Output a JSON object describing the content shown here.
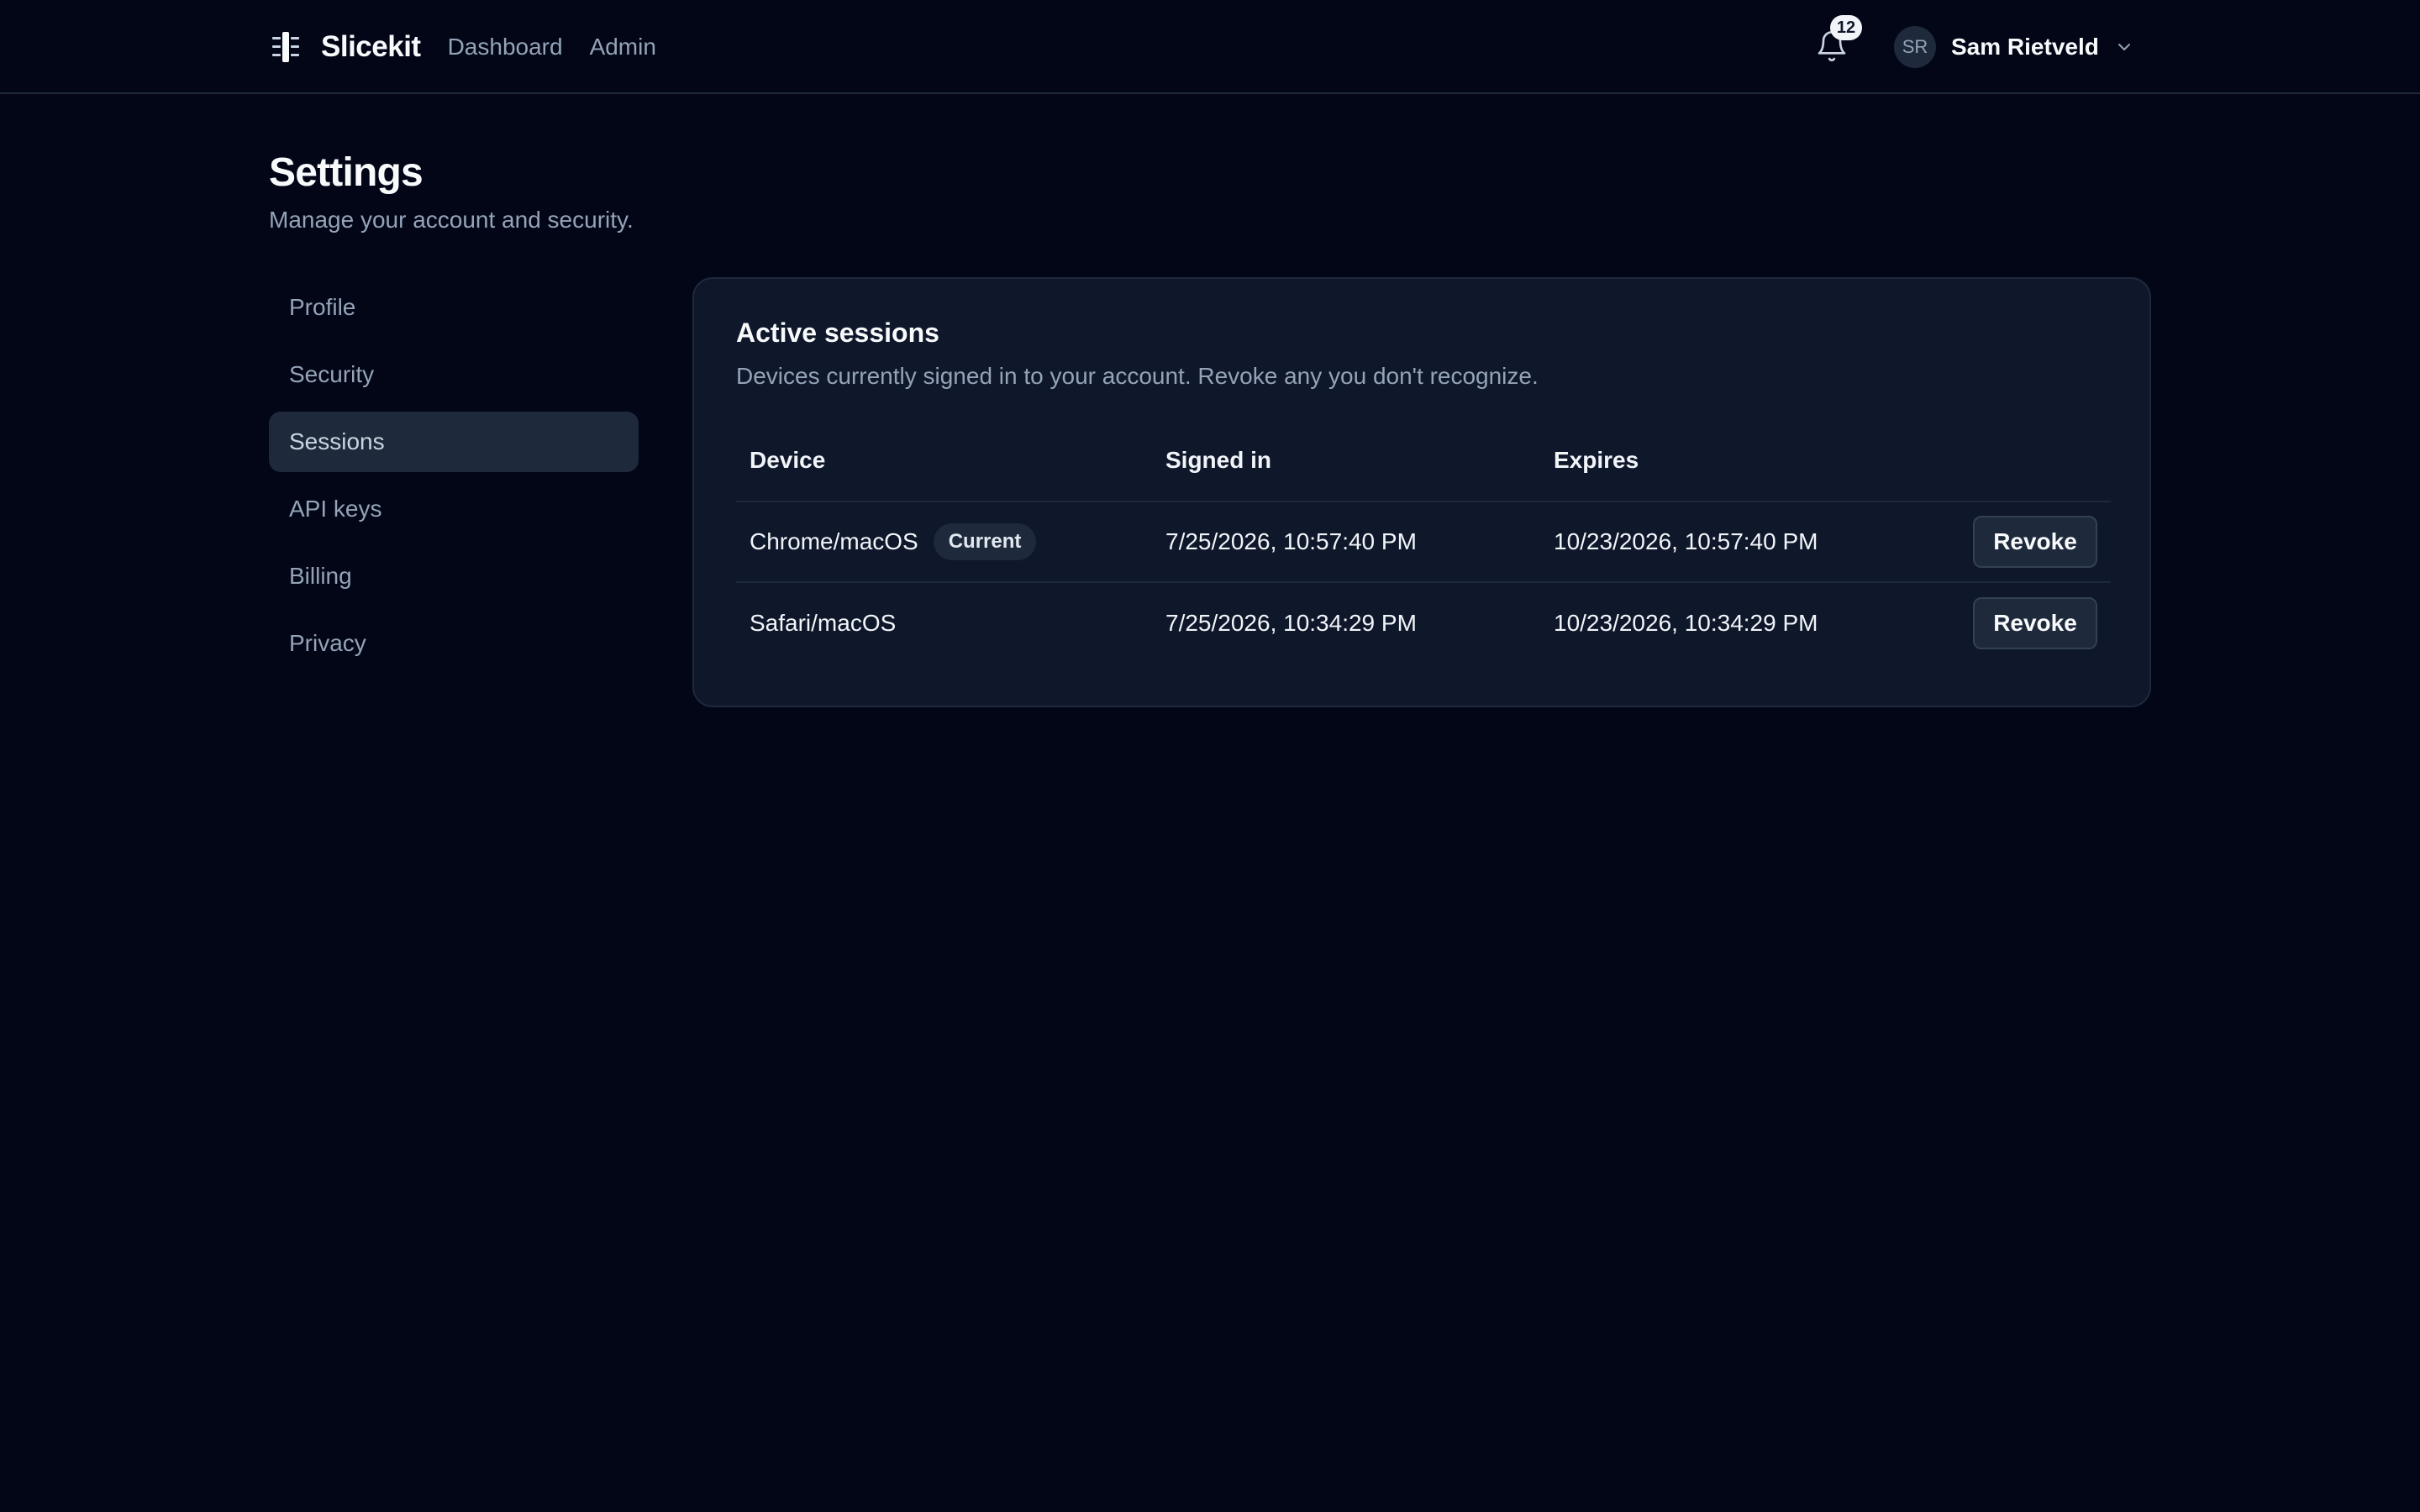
{
  "header": {
    "brand": "Slicekit",
    "nav": [
      "Dashboard",
      "Admin"
    ],
    "notifications": {
      "count": "12",
      "icon": "bell-icon"
    },
    "user": {
      "initials": "SR",
      "name": "Sam Rietveld",
      "menu_icon": "chevron-down-icon"
    }
  },
  "page": {
    "title": "Settings",
    "subtitle": "Manage your account and security."
  },
  "sidebar": {
    "active": "Sessions",
    "items": [
      {
        "label": "Profile"
      },
      {
        "label": "Security"
      },
      {
        "label": "Sessions"
      },
      {
        "label": "API keys"
      },
      {
        "label": "Billing"
      },
      {
        "label": "Privacy"
      }
    ]
  },
  "sessions": {
    "title": "Active sessions",
    "description": "Devices currently signed in to your account. Revoke any you don't recognize.",
    "columns": {
      "device": "Device",
      "signed_in": "Signed in",
      "expires": "Expires"
    },
    "rows": [
      {
        "device": "Chrome/macOS",
        "badge": "Current",
        "signed_in": "7/25/2026, 10:57:40 PM",
        "expires": "10/23/2026, 10:57:40 PM",
        "action": "Revoke"
      },
      {
        "device": "Safari/macOS",
        "signed_in": "7/25/2026, 10:34:29 PM",
        "expires": "10/23/2026, 10:34:29 PM",
        "action": "Revoke"
      }
    ]
  },
  "colors": {
    "background": "#020617",
    "card": "#0f172a",
    "border": "#1e293b",
    "muted_text": "#94a3b8",
    "text": "#f8fafc"
  }
}
